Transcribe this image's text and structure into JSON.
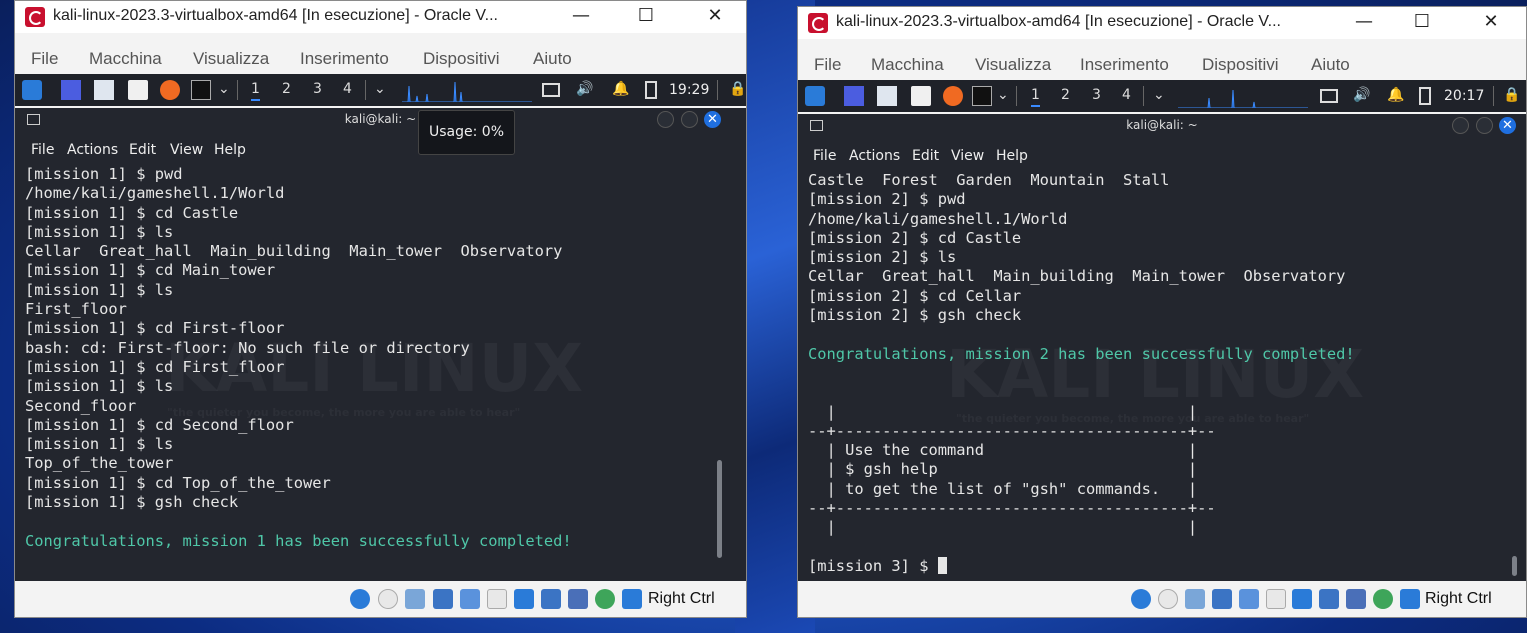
{
  "windows": [
    {
      "title": "kali-linux-2023.3-virtualbox-amd64 [In esecuzione] - Oracle V...",
      "menu": [
        "File",
        "Macchina",
        "Visualizza",
        "Inserimento",
        "Dispositivi",
        "Aiuto"
      ],
      "workspaces": [
        "1",
        "2",
        "3",
        "4"
      ],
      "clock": "19:29",
      "terminal_title": "kali@kali: ~",
      "terminal_menu": [
        "File",
        "Actions",
        "Edit",
        "View",
        "Help"
      ],
      "tooltip": "Usage: 0%",
      "lines": [
        "[mission 1] $ pwd",
        "/home/kali/gameshell.1/World",
        "[mission 1] $ cd Castle",
        "[mission 1] $ ls",
        "Cellar  Great_hall  Main_building  Main_tower  Observatory",
        "[mission 1] $ cd Main_tower",
        "[mission 1] $ ls",
        "First_floor",
        "[mission 1] $ cd First-floor",
        "bash: cd: First-floor: No such file or directory",
        "[mission 1] $ cd First_floor",
        "[mission 1] $ ls",
        "Second_floor",
        "[mission 1] $ cd Second_floor",
        "[mission 1] $ ls",
        "Top_of_the_tower",
        "[mission 1] $ cd Top_of_the_tower",
        "[mission 1] $ gsh check",
        "",
        "Congratulations, mission 1 has been successfully completed!"
      ],
      "host_key": "Right Ctrl"
    },
    {
      "title": "kali-linux-2023.3-virtualbox-amd64 [In esecuzione] - Oracle V...",
      "menu": [
        "File",
        "Macchina",
        "Visualizza",
        "Inserimento",
        "Dispositivi",
        "Aiuto"
      ],
      "workspaces": [
        "1",
        "2",
        "3",
        "4"
      ],
      "clock": "20:17",
      "terminal_title": "kali@kali: ~",
      "terminal_menu": [
        "File",
        "Actions",
        "Edit",
        "View",
        "Help"
      ],
      "lines": [
        "Castle  Forest  Garden  Mountain  Stall",
        "[mission 2] $ pwd",
        "/home/kali/gameshell.1/World",
        "[mission 2] $ cd Castle",
        "[mission 2] $ ls",
        "Cellar  Great_hall  Main_building  Main_tower  Observatory",
        "[mission 2] $ cd Cellar",
        "[mission 2] $ gsh check",
        "",
        "Congratulations, mission 2 has been successfully completed!",
        "",
        "",
        "  |                                      |",
        "--+--------------------------------------+--",
        "  | Use the command                      |",
        "  | $ gsh help                           |",
        "  | to get the list of \"gsh\" commands.   |",
        "--+--------------------------------------+--",
        "  |                                      |",
        "",
        "[mission 3] $ "
      ],
      "host_key": "Right Ctrl"
    }
  ],
  "watermark": {
    "brand": "KALI LINUX",
    "motto": "\"the quieter you become, the more you are able to hear\""
  },
  "colors": {
    "success": "#4fc7a8",
    "terminal_bg": "#23262e",
    "panel_bg": "#1f2229",
    "accent": "#1f6fe0"
  }
}
